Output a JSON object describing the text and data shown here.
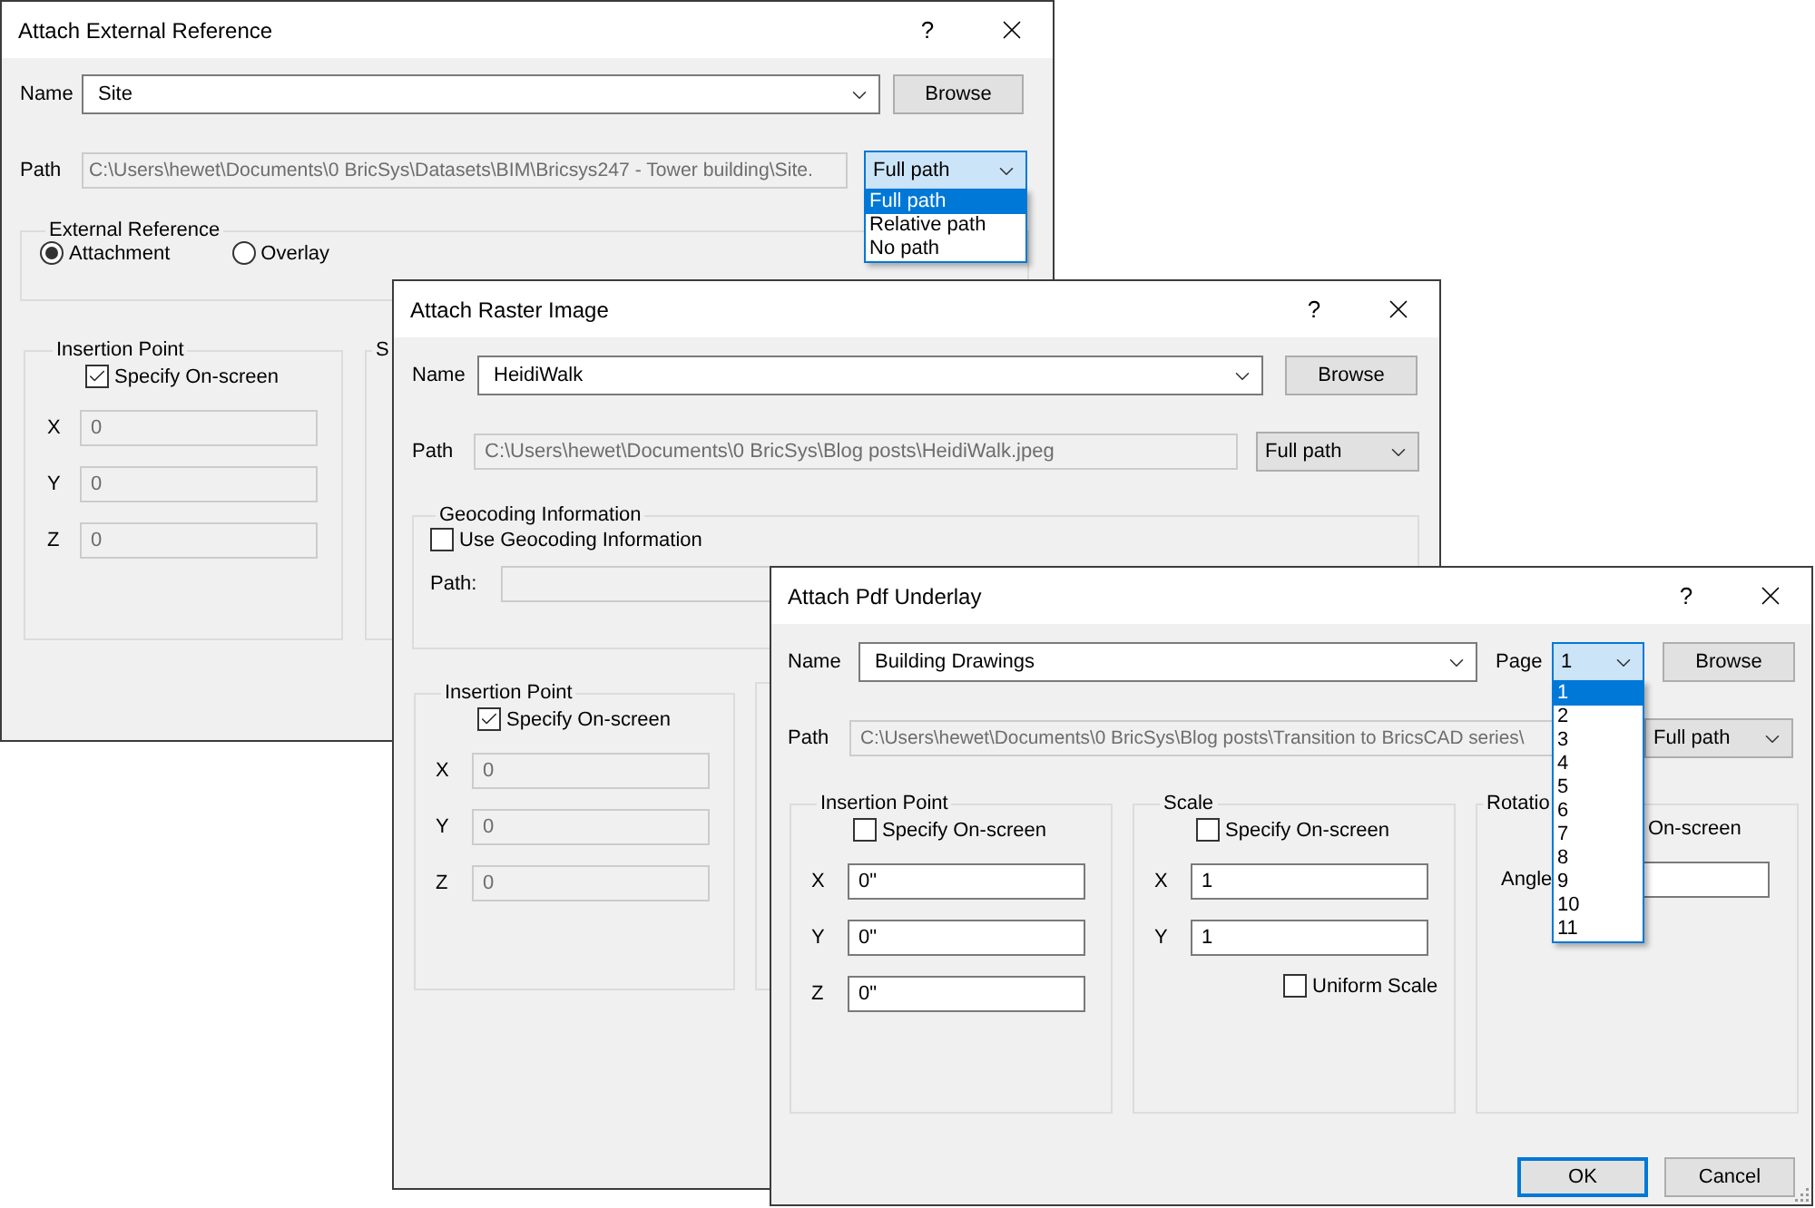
{
  "external_reference_dialog": {
    "title": "Attach External Reference",
    "help_button": "?",
    "name": {
      "label": "Name",
      "value": "Site"
    },
    "browse_button": "Browse",
    "path": {
      "label": "Path",
      "value": "C:\\Users\\hewet\\Documents\\0 BricSys\\Datasets\\BIM\\Bricsys247 - Tower building\\Site.",
      "type_dropdown": {
        "value": "Full path",
        "open": true,
        "options": [
          {
            "label": "Full path",
            "selected": true
          },
          {
            "label": "Relative path",
            "selected": false
          },
          {
            "label": "No path",
            "selected": false
          }
        ]
      }
    },
    "reference_type": {
      "title": "External Reference",
      "options": [
        {
          "label": "Attachment",
          "selected": true
        },
        {
          "label": "Overlay",
          "selected": false
        }
      ]
    },
    "insertion_point": {
      "title": "Insertion Point",
      "specify_on_screen": {
        "label": "Specify On-screen",
        "checked": true
      },
      "coordinates": [
        {
          "axis": "X",
          "value": "0",
          "disabled": true
        },
        {
          "axis": "Y",
          "value": "0",
          "disabled": true
        },
        {
          "axis": "Z",
          "value": "0",
          "disabled": true
        }
      ]
    },
    "scale_group": {
      "title": "S"
    }
  },
  "raster_image_dialog": {
    "title": "Attach Raster Image",
    "help_button": "?",
    "name": {
      "label": "Name",
      "value": "HeidiWalk"
    },
    "browse_button": "Browse",
    "path": {
      "label": "Path",
      "value": "C:\\Users\\hewet\\Documents\\0 BricSys\\Blog posts\\HeidiWalk.jpeg",
      "type_dropdown": {
        "value": "Full path",
        "open": false
      }
    },
    "geocoding": {
      "title": "Geocoding Information",
      "use_geocoding": {
        "label": "Use Geocoding Information",
        "checked": false
      },
      "path_label": "Path:"
    },
    "insertion_point": {
      "title": "Insertion Point",
      "specify_on_screen": {
        "label": "Specify On-screen",
        "checked": true
      },
      "coordinates": [
        {
          "axis": "X",
          "value": "0",
          "disabled": true
        },
        {
          "axis": "Y",
          "value": "0",
          "disabled": true
        },
        {
          "axis": "Z",
          "value": "0",
          "disabled": true
        }
      ]
    }
  },
  "pdf_underlay_dialog": {
    "title": "Attach Pdf Underlay",
    "help_button": "?",
    "name": {
      "label": "Name",
      "value": "Building Drawings"
    },
    "page": {
      "label": "Page",
      "value": "1",
      "open": true,
      "options": [
        {
          "label": "1",
          "selected": true
        },
        {
          "label": "2",
          "selected": false
        },
        {
          "label": "3",
          "selected": false
        },
        {
          "label": "4",
          "selected": false
        },
        {
          "label": "5",
          "selected": false
        },
        {
          "label": "6",
          "selected": false
        },
        {
          "label": "7",
          "selected": false
        },
        {
          "label": "8",
          "selected": false
        },
        {
          "label": "9",
          "selected": false
        },
        {
          "label": "10",
          "selected": false
        },
        {
          "label": "11",
          "selected": false
        }
      ]
    },
    "browse_button": "Browse",
    "path": {
      "label": "Path",
      "value": "C:\\Users\\hewet\\Documents\\0 BricSys\\Blog posts\\Transition to BricsCAD series\\",
      "type_dropdown": {
        "value": "Full path",
        "open": false
      }
    },
    "insertion_point": {
      "title": "Insertion Point",
      "specify_on_screen": {
        "label": "Specify On-screen",
        "checked": false
      },
      "coordinates": [
        {
          "axis": "X",
          "value": "0\"",
          "disabled": false
        },
        {
          "axis": "Y",
          "value": "0\"",
          "disabled": false
        },
        {
          "axis": "Z",
          "value": "0\"",
          "disabled": false
        }
      ]
    },
    "scale": {
      "title": "Scale",
      "specify_on_screen": {
        "label": "Specify On-screen",
        "checked": false
      },
      "coordinates": [
        {
          "axis": "X",
          "value": "1",
          "disabled": false
        },
        {
          "axis": "Y",
          "value": "1",
          "disabled": false
        }
      ],
      "uniform_scale": {
        "label": "Uniform Scale",
        "checked": false
      }
    },
    "rotation": {
      "title": "Rotatio",
      "on_screen_label": "On-screen",
      "angle": {
        "label": "Angle"
      }
    },
    "buttons": [
      {
        "label": "OK",
        "default": true
      },
      {
        "label": "Cancel",
        "default": false
      }
    ]
  }
}
